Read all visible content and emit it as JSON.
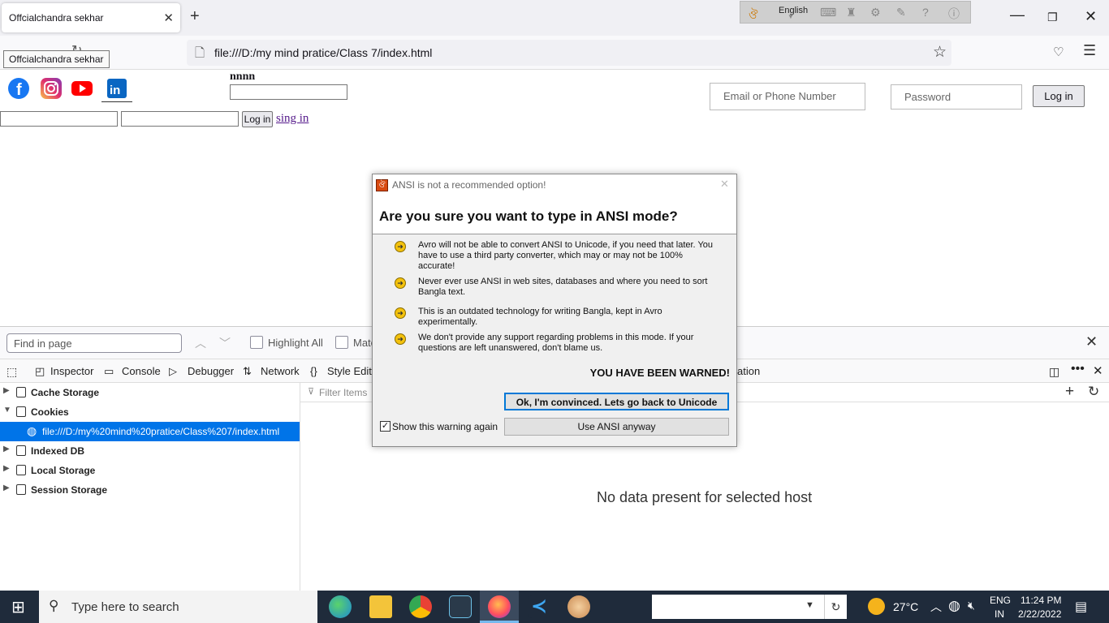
{
  "browser": {
    "tab_title": "Offcialchandra sekhar",
    "tab_close": "✕",
    "new_tab": "+",
    "tooltip": "Offcialchandra sekhar",
    "url": "file:///D:/my mind pratice/Class 7/index.html",
    "avro_language": "English",
    "window_controls": {
      "minimize": "—",
      "restore": "❐",
      "close": "✕"
    }
  },
  "page": {
    "label_text": "nnnn",
    "login_button": "Log in",
    "signin_link": "sing in",
    "fb_email_placeholder": "Email or Phone Number",
    "fb_password_placeholder": "Password",
    "fb_login_button": "Log in",
    "social_icons": [
      "facebook-icon",
      "instagram-icon",
      "youtube-icon",
      "linkedin-icon"
    ]
  },
  "findbar": {
    "placeholder": "Find in page",
    "highlight_all": "Highlight All",
    "match_case": "Matc"
  },
  "devtools": {
    "tabs": [
      "Inspector",
      "Console",
      "Debugger",
      "Network",
      "Style Editor"
    ],
    "tab_tail": "ation",
    "filter_placeholder": "Filter Items",
    "tree": [
      {
        "label": "Cache Storage",
        "expanded": false
      },
      {
        "label": "Cookies",
        "expanded": true
      },
      {
        "label": "file:///D:/my%20mind%20pratice/Class%207/index.html",
        "selected": true
      },
      {
        "label": "Indexed DB",
        "expanded": false
      },
      {
        "label": "Local Storage",
        "expanded": false
      },
      {
        "label": "Session Storage",
        "expanded": false
      }
    ],
    "empty_message": "No data present for selected host"
  },
  "dialog": {
    "title": "ANSI is not a recommended option!",
    "heading": "Are you sure you want to type in ANSI mode?",
    "bullets": [
      "Avro will not be able to convert ANSI to Unicode, if you need that later. You have to use a third party converter, which may or may not be 100% accurate!",
      "Never ever use ANSI in web sites, databases and where you need to sort Bangla text.",
      "This is an outdated technology for writing Bangla, kept in Avro experimentally.",
      "We don't provide any support regarding problems in this mode. If your questions are left unanswered, don't blame us."
    ],
    "warning": "YOU HAVE BEEN WARNED!",
    "ok_button": "Ok, I'm convinced. Lets go back to Unicode",
    "ansi_button": "Use ANSI anyway",
    "checkbox_label": "Show this warning again",
    "checkbox_checked": true
  },
  "taskbar": {
    "search_placeholder": "Type here to search",
    "temperature": "27°C",
    "lang_top": "ENG",
    "lang_bottom": "IN",
    "time": "11:24 PM",
    "date": "2/22/2022"
  }
}
